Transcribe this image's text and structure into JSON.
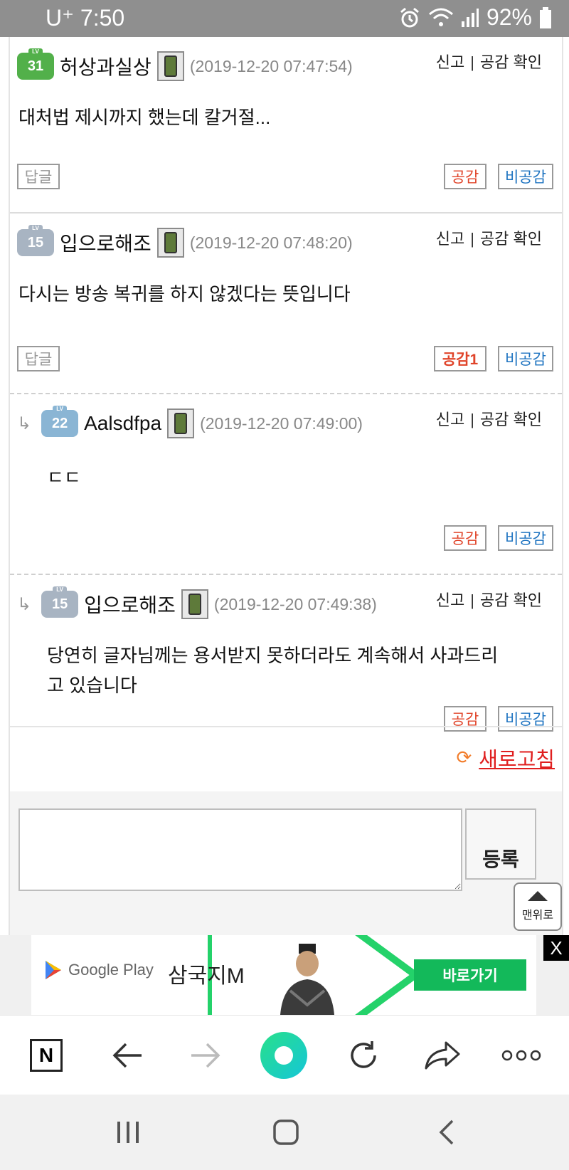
{
  "status_bar": {
    "carrier": "U⁺",
    "time": "7:50",
    "battery": "92%",
    "icons": [
      "alarm-icon",
      "wifi-icon",
      "signal-icon",
      "battery-icon"
    ]
  },
  "comments": [
    {
      "level": "31",
      "nickname": "허상과실상",
      "date": "(2019-12-20 07:47:54)",
      "report": "신고",
      "separator": "|",
      "check": "공감 확인",
      "body": "대처법 제시까지 했는데 칼거절...",
      "reply_label": "답글",
      "like_label": "공감",
      "dislike_label": "비공감"
    },
    {
      "level": "15",
      "nickname": "입으로해조",
      "date": "(2019-12-20 07:48:20)",
      "report": "신고",
      "separator": "|",
      "check": "공감 확인",
      "body": "다시는 방송 복귀를 하지 않겠다는 뜻입니다",
      "reply_label": "답글",
      "like_label": "공감1",
      "dislike_label": "비공감"
    },
    {
      "level": "22",
      "nickname": "Aalsdfpa",
      "date": "(2019-12-20 07:49:00)",
      "report": "신고",
      "separator": "|",
      "check": "공감 확인",
      "body": "ㄷㄷ",
      "like_label": "공감",
      "dislike_label": "비공감"
    },
    {
      "level": "15",
      "nickname": "입으로해조",
      "date": "(2019-12-20 07:49:38)",
      "report": "신고",
      "separator": "|",
      "check": "공감 확인",
      "body_line1": "당연히 글자님께는 용서받지 못하더라도 계속해서 사과드리",
      "body_line2": "고 있습니다",
      "like_label": "공감",
      "dislike_label": "비공감"
    }
  ],
  "reply_arrow": "↳",
  "refresh": {
    "icon": "refresh-icon",
    "label": "새로고침"
  },
  "comment_form": {
    "textarea_value": "",
    "submit_label": "등록"
  },
  "to_top": {
    "label": "맨위로"
  },
  "ad": {
    "store": "Google Play",
    "title": "삼국지M",
    "cta": "바로가기",
    "info": "!",
    "close": "X"
  },
  "toolbar": {
    "items": [
      "naver-home-icon",
      "back-icon",
      "forward-icon",
      "green-dot-icon",
      "reload-icon",
      "share-icon",
      "more-icon"
    ],
    "home_letter": "N"
  },
  "navbar": {
    "items": [
      "recent-apps-icon",
      "home-icon",
      "back-icon"
    ]
  },
  "colors": {
    "like": "#e0442a",
    "dislike": "#1f74c1",
    "refresh": "#e01f1f",
    "ad_green": "#13b95a"
  }
}
